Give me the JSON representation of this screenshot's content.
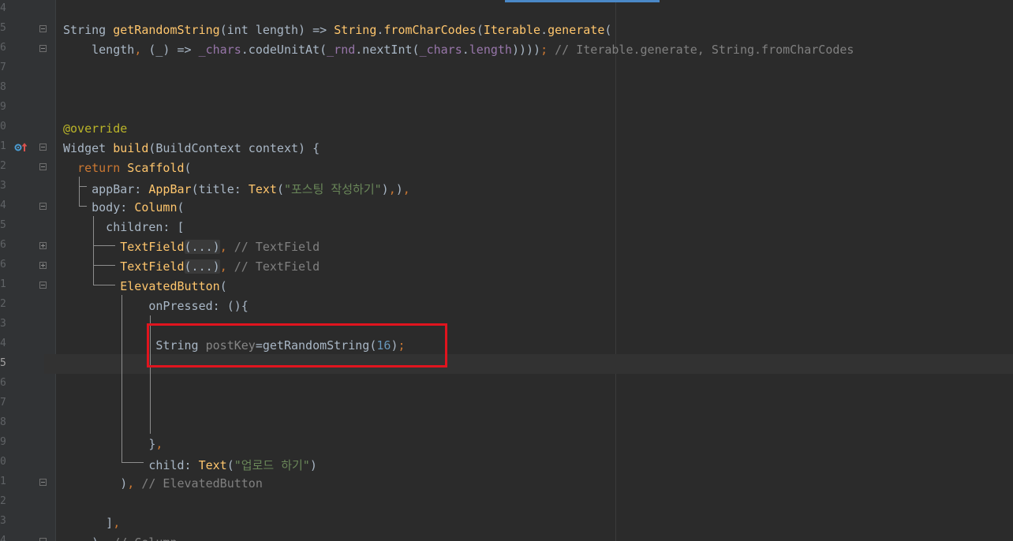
{
  "editor": {
    "colors": {
      "background": "#2b2b2b",
      "gutter": "#313335",
      "keyword": "#cc7832",
      "function": "#ffc66d",
      "string": "#6a8759",
      "number": "#6897bb",
      "comment": "#808080",
      "annotation": "#bbb529",
      "field": "#9876aa",
      "text": "#a9b7c6",
      "highlight_box": "#e0141e",
      "top_accent": "#4a88c7"
    },
    "gutter_icons": [
      "override-marker-icon",
      "fold-icon"
    ],
    "lines": [
      {
        "num": "4",
        "tokens": []
      },
      {
        "num": "5",
        "tokens": [
          [
            "t",
            "String "
          ],
          [
            "fn",
            "getRandomString"
          ],
          [
            "t",
            "(int length) => "
          ],
          [
            "fn",
            "String"
          ],
          [
            "t",
            "."
          ],
          [
            "fn",
            "fromCharCodes"
          ],
          [
            "t",
            "("
          ],
          [
            "fn",
            "Iterable"
          ],
          [
            "t",
            "."
          ],
          [
            "fn",
            "generate"
          ],
          [
            "t",
            "("
          ]
        ]
      },
      {
        "num": "6",
        "tokens": [
          [
            "t",
            "    length"
          ],
          [
            "kw",
            ", "
          ],
          [
            "t",
            "(_) => "
          ],
          [
            "fld",
            "_chars"
          ],
          [
            "t",
            ".codeUnitAt("
          ],
          [
            "fld",
            "_rnd"
          ],
          [
            "t",
            ".nextInt("
          ],
          [
            "fld",
            "_chars"
          ],
          [
            "t",
            "."
          ],
          [
            "fld",
            "length"
          ],
          [
            "t",
            "))))"
          ],
          [
            "kw",
            "; "
          ],
          [
            "com",
            "// Iterable.generate, String.fromCharCodes"
          ]
        ]
      },
      {
        "num": "7",
        "tokens": []
      },
      {
        "num": "8",
        "tokens": []
      },
      {
        "num": "9",
        "tokens": []
      },
      {
        "num": "0",
        "tokens": [
          [
            "ann",
            "@override"
          ]
        ]
      },
      {
        "num": "1",
        "tokens": [
          [
            "t",
            "Widget "
          ],
          [
            "fn",
            "build"
          ],
          [
            "t",
            "(BuildContext context) {"
          ]
        ]
      },
      {
        "num": "2",
        "tokens": [
          [
            "t",
            "  "
          ],
          [
            "kw",
            "return "
          ],
          [
            "fn",
            "Scaffold"
          ],
          [
            "t",
            "("
          ]
        ]
      },
      {
        "num": "3",
        "tokens": [
          [
            "t",
            "    appBar: "
          ],
          [
            "fn",
            "AppBar"
          ],
          [
            "t",
            "(title: "
          ],
          [
            "fn",
            "Text"
          ],
          [
            "t",
            "("
          ],
          [
            "str",
            "\"포스팅 작성하기\""
          ],
          [
            "t",
            ")"
          ],
          [
            "kw",
            ","
          ],
          [
            "t",
            ")"
          ],
          [
            "kw",
            ","
          ]
        ]
      },
      {
        "num": "4",
        "tokens": [
          [
            "t",
            "    body: "
          ],
          [
            "fn",
            "Column"
          ],
          [
            "t",
            "("
          ]
        ]
      },
      {
        "num": "5",
        "tokens": [
          [
            "t",
            "      children: ["
          ]
        ]
      },
      {
        "num": "6",
        "tokens": [
          [
            "t",
            "        "
          ],
          [
            "fn",
            "TextField"
          ],
          [
            "fold",
            "(...)"
          ],
          [
            "kw",
            ", "
          ],
          [
            "com",
            "// TextField"
          ]
        ]
      },
      {
        "num": "6",
        "tokens": [
          [
            "t",
            "        "
          ],
          [
            "fn",
            "TextField"
          ],
          [
            "fold",
            "(...)"
          ],
          [
            "kw",
            ", "
          ],
          [
            "com",
            "// TextField"
          ]
        ]
      },
      {
        "num": "1",
        "tokens": [
          [
            "t",
            "        "
          ],
          [
            "fn",
            "ElevatedButton"
          ],
          [
            "t",
            "("
          ]
        ]
      },
      {
        "num": "2",
        "tokens": [
          [
            "t",
            "            onPressed: (){"
          ]
        ]
      },
      {
        "num": "3",
        "tokens": []
      },
      {
        "num": "4",
        "tokens": [
          [
            "t",
            "             String "
          ],
          [
            "grey",
            "postKey"
          ],
          [
            "t",
            "="
          ],
          [
            "t",
            "getRandomString("
          ],
          [
            "num",
            "16"
          ],
          [
            "t",
            ")"
          ],
          [
            "kw",
            ";"
          ]
        ]
      },
      {
        "num": "5",
        "tokens": [],
        "current": true
      },
      {
        "num": "6",
        "tokens": []
      },
      {
        "num": "7",
        "tokens": []
      },
      {
        "num": "8",
        "tokens": []
      },
      {
        "num": "9",
        "tokens": [
          [
            "t",
            "            }"
          ],
          [
            "kw",
            ","
          ]
        ]
      },
      {
        "num": "0",
        "tokens": [
          [
            "t",
            "            child: "
          ],
          [
            "fn",
            "Text"
          ],
          [
            "t",
            "("
          ],
          [
            "str",
            "\"업로드 하기\""
          ],
          [
            "t",
            ")"
          ]
        ]
      },
      {
        "num": "1",
        "tokens": [
          [
            "t",
            "        )"
          ],
          [
            "kw",
            ", "
          ],
          [
            "com",
            "// ElevatedButton"
          ]
        ]
      },
      {
        "num": "2",
        "tokens": []
      },
      {
        "num": "3",
        "tokens": [
          [
            "t",
            "      ]"
          ],
          [
            "kw",
            ","
          ]
        ]
      },
      {
        "num": "4",
        "tokens": [
          [
            "t",
            "    )"
          ],
          [
            "kw",
            ", "
          ],
          [
            "com",
            "// Column"
          ]
        ]
      }
    ]
  }
}
